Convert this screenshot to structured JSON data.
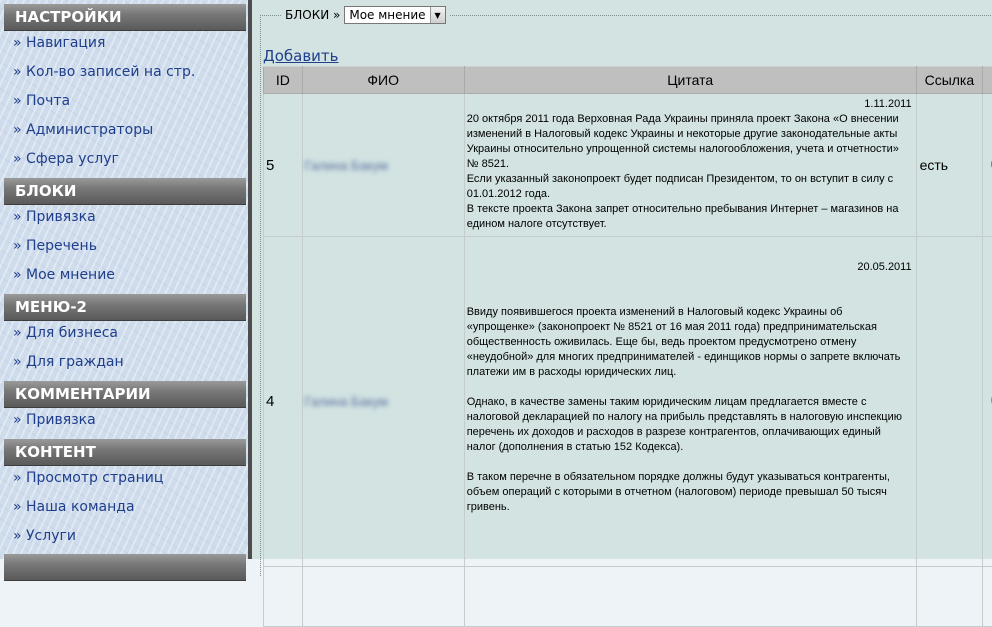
{
  "sidebar": {
    "sections": [
      {
        "title": "НАСТРОЙКИ",
        "items": [
          "» Навигация",
          "» Кол-во записей на стр.",
          "» Почта",
          "» Администраторы",
          "» Сфера услуг"
        ]
      },
      {
        "title": "БЛОКИ",
        "items": [
          "» Привязка",
          "» Перечень",
          "» Мое мнение"
        ]
      },
      {
        "title": "МЕНЮ-2",
        "items": [
          "» Для бизнеса",
          "» Для граждан"
        ]
      },
      {
        "title": "КОММЕНТАРИИ",
        "items": [
          "» Привязка"
        ]
      },
      {
        "title": "КОНТЕНТ",
        "items": [
          "» Просмотр страниц",
          "» Наша команда",
          "» Услуги"
        ]
      }
    ]
  },
  "main": {
    "legend_label": "БЛОКИ »",
    "select_value": "Мое мнение",
    "add_link": "Добавить",
    "columns": [
      "ID",
      "ФИО",
      "Цитата",
      "Ссылка",
      "",
      ""
    ],
    "rows": [
      {
        "id": "5",
        "fio": "Галина Бакум",
        "date": "1.11.2011",
        "text": "20 октября 2011 года Верховная Рада Украины приняла проект Закона «О внесении изменений в Налоговый кодекс Украины и некоторые другие законодательные акты Украины относительно упрощенной системы налогообложения, учета и отчетности» № 8521.\nЕсли указанный законопроект будет подписан Президентом, то он вступит в силу с 01.01.2012 года.\nВ тексте проекта Закона запрет относительно пребывания Интернет – магазинов на едином налоге отсутствует.",
        "link": "есть",
        "active": true
      },
      {
        "id": "4",
        "fio": "Галина Бакум",
        "date": "20.05.2011",
        "text": "\n\nВвиду появившегося проекта изменений в Налоговый кодекс Украины об «упрощенке» (законопроект № 8521 от 16 мая 2011 года) предпринимательская общественность оживилась. Еще бы, ведь проектом предусмотрено отмену «неудобной» для многих предпринимателей - единщиков нормы о запрете включать платежи им в расходы юридических лиц.\n\nОднако, в качестве замены таким юридическим лицам предлагается вместе с налоговой декларацией по налогу на прибыль представлять в налоговую инспекцию перечень их доходов и расходов в разрезе контрагентов, оплачивающих единый налог (дополнения в статью 152 Кодекса).\n\nВ таком перечне в обязательном порядке должны будут указываться контрагенты, объем операций с которыми в отчетном (налоговом) периоде превышал 50 тысяч гривень.",
        "link": "",
        "active": false
      }
    ]
  },
  "colors": {
    "header_gradient_top": "#9a9a9a",
    "link_blue": "#1f3e8c",
    "main_bg": "#d2e3e2",
    "delete_red": "#d02121"
  },
  "icons": {
    "active": "lightbulb-on-icon",
    "inactive": "lightbulb-off-icon",
    "delete": "delete-x-icon",
    "dropdown": "chevron-down-icon"
  }
}
